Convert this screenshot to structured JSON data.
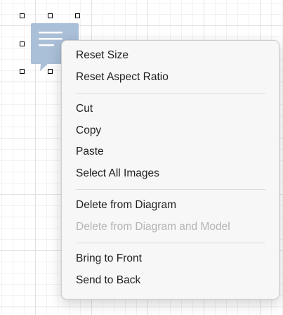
{
  "canvas": {
    "grid_color": "#e2e2e2"
  },
  "selected_shape": {
    "icon": "speech-bubble-icon",
    "fill_color": "#aabfd8",
    "line_color": "#ffffff"
  },
  "context_menu": {
    "groups": [
      {
        "items": [
          {
            "label": "Reset Size",
            "enabled": true
          },
          {
            "label": "Reset Aspect Ratio",
            "enabled": true
          }
        ]
      },
      {
        "items": [
          {
            "label": "Cut",
            "enabled": true
          },
          {
            "label": "Copy",
            "enabled": true
          },
          {
            "label": "Paste",
            "enabled": true
          },
          {
            "label": "Select All Images",
            "enabled": true
          }
        ]
      },
      {
        "items": [
          {
            "label": "Delete from Diagram",
            "enabled": true
          },
          {
            "label": "Delete from Diagram and Model",
            "enabled": false
          }
        ]
      },
      {
        "items": [
          {
            "label": "Bring to Front",
            "enabled": true
          },
          {
            "label": "Send to Back",
            "enabled": true
          }
        ]
      }
    ]
  }
}
